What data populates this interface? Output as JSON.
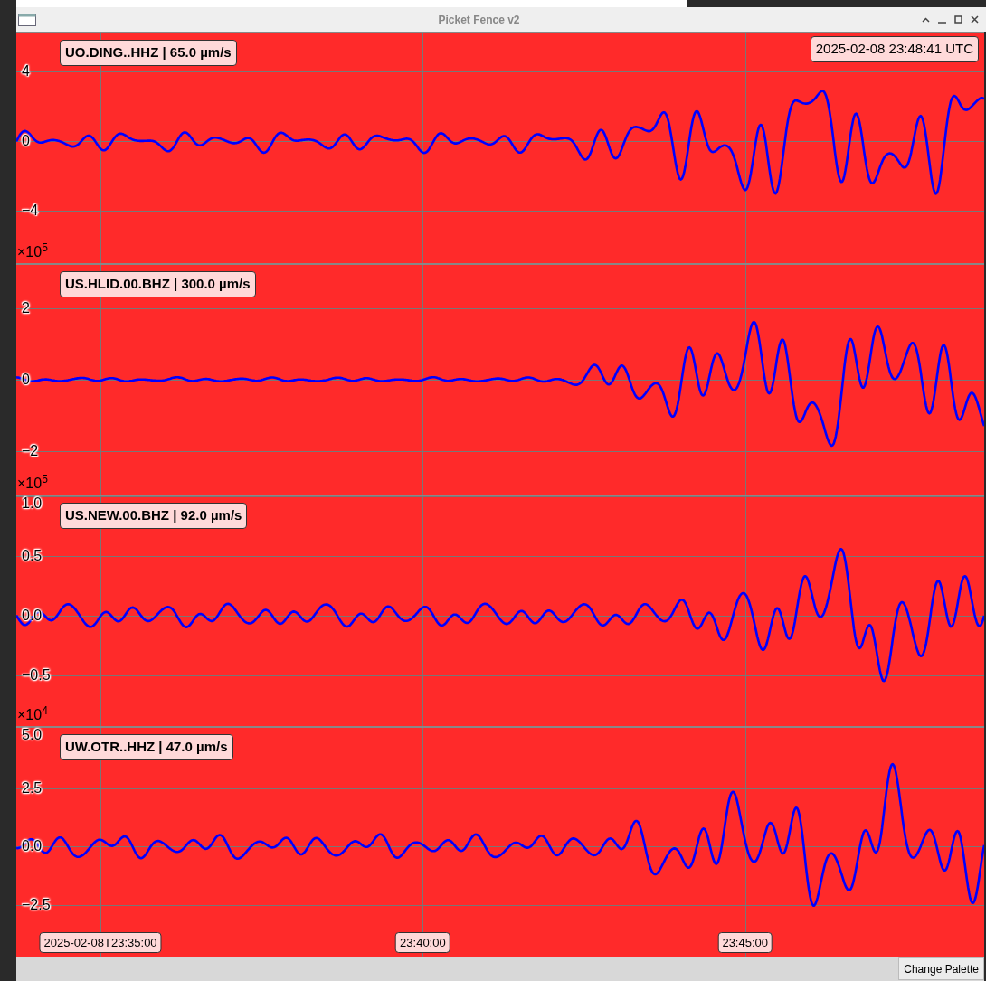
{
  "window": {
    "title": "Picket Fence v2"
  },
  "timestamp": "2025-02-08 23:48:41 UTC",
  "panels": [
    {
      "label": "UO.DING..HHZ | 65.0 µm/s",
      "yticks": [
        "4",
        "0",
        "−4"
      ]
    },
    {
      "label": "US.HLID.00.BHZ | 300.0 µm/s",
      "multiplier": "×10$^{5}$",
      "yticks": [
        "2",
        "0",
        "−2"
      ]
    },
    {
      "label": "US.NEW.00.BHZ | 92.0 µm/s",
      "multiplier": "×10$^{5}$",
      "yticks": [
        "1.0",
        "0.5",
        "0.0",
        "−0.5"
      ]
    },
    {
      "label": "UW.OTR..HHZ | 47.0 µm/s",
      "multiplier": "×10$^{4}$",
      "yticks": [
        "5.0",
        "2.5",
        "0.0",
        "−2.5"
      ]
    }
  ],
  "time_labels": [
    "2025-02-08T23:35:00",
    "23:40:00",
    "23:45:00"
  ],
  "button": "Change Palette"
}
